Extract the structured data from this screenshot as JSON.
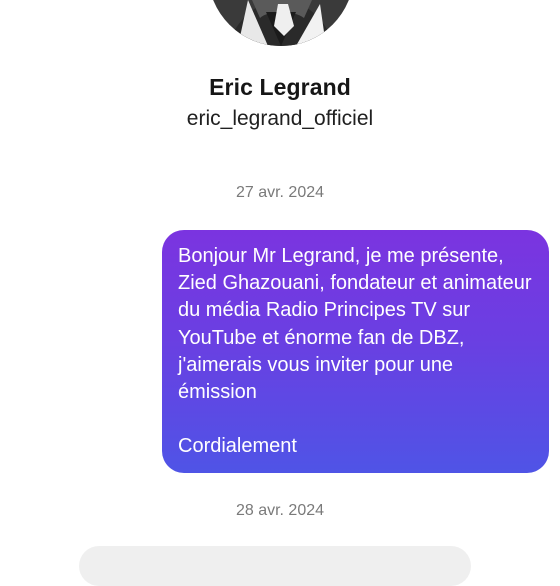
{
  "profile": {
    "name": "Eric Legrand",
    "handle": "eric_legrand_officiel"
  },
  "thread": {
    "messages": [
      {
        "date": "27 avr. 2024",
        "direction": "outgoing",
        "text": "Bonjour Mr Legrand, je me présente, Zied Ghazouani, fondateur et animateur du média Radio Principes TV sur YouTube et énorme fan de DBZ, j'aimerais vous inviter pour une émission\n\nCordialement"
      },
      {
        "date": "28 avr. 2024",
        "direction": "incoming",
        "text": ""
      }
    ]
  },
  "colors": {
    "outgoing_bubble_top": "#7b34e0",
    "outgoing_bubble_bottom": "#4f54e6",
    "incoming_bubble": "#efefef",
    "date_text": "#7a7a7a"
  }
}
